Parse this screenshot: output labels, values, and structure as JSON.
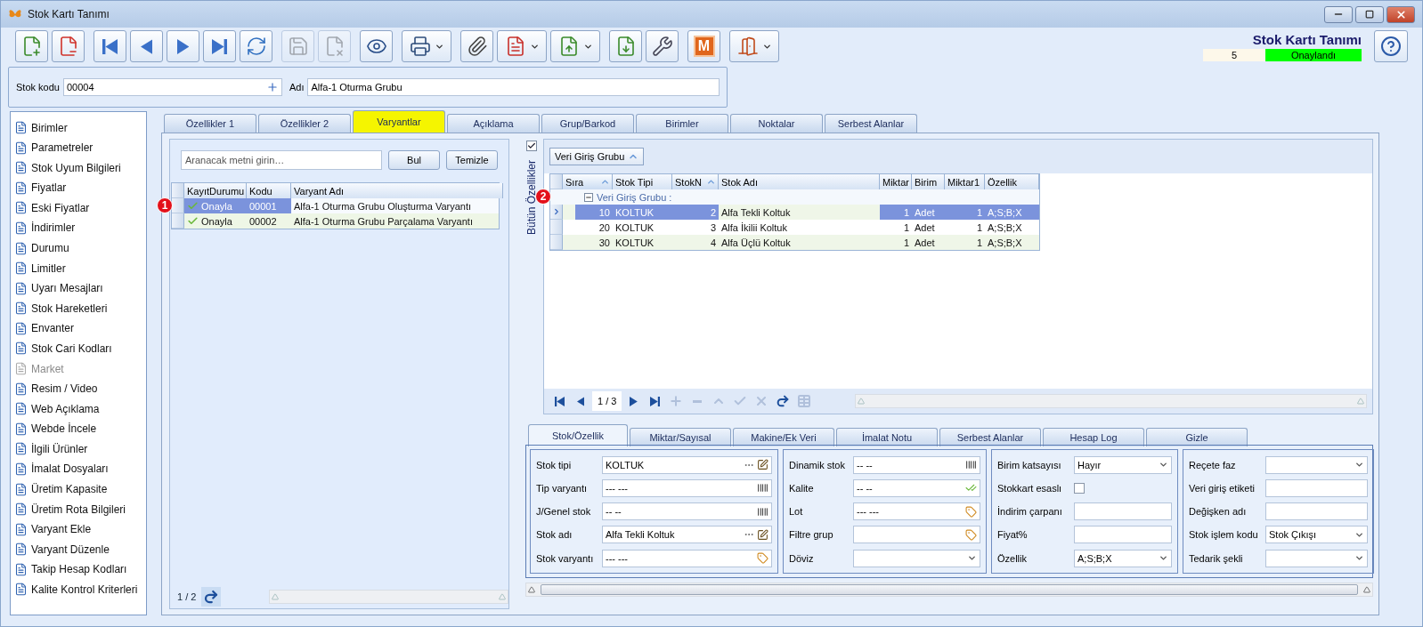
{
  "window": {
    "title": "Stok Kartı Tanımı"
  },
  "toolbar": [
    {
      "kind": "new",
      "disabled": false,
      "dropdown": false
    },
    {
      "kind": "delete",
      "disabled": false,
      "dropdown": false
    },
    {
      "kind": "first",
      "disabled": false,
      "dropdown": false
    },
    {
      "kind": "prev",
      "disabled": false,
      "dropdown": false
    },
    {
      "kind": "next",
      "disabled": false,
      "dropdown": false
    },
    {
      "kind": "last",
      "disabled": false,
      "dropdown": false
    },
    {
      "kind": "refresh",
      "disabled": false,
      "dropdown": false
    },
    {
      "kind": "save",
      "disabled": true,
      "dropdown": false
    },
    {
      "kind": "cancel",
      "disabled": true,
      "dropdown": false
    },
    {
      "kind": "preview",
      "disabled": false,
      "dropdown": false
    },
    {
      "kind": "print",
      "disabled": false,
      "dropdown": true
    },
    {
      "kind": "attach",
      "disabled": false,
      "dropdown": false
    },
    {
      "kind": "pdf",
      "disabled": false,
      "dropdown": true
    },
    {
      "kind": "export",
      "disabled": false,
      "dropdown": true
    },
    {
      "kind": "import",
      "disabled": false,
      "dropdown": false
    },
    {
      "kind": "tools",
      "disabled": false,
      "dropdown": false
    },
    {
      "kind": "module",
      "label": "M",
      "disabled": false,
      "dropdown": false
    },
    {
      "kind": "exit",
      "disabled": false,
      "dropdown": true
    }
  ],
  "header": {
    "title": "Stok Kartı Tanımı",
    "number": "5",
    "status": "Onaylandı"
  },
  "code_row": {
    "code_label": "Stok kodu",
    "code": "00004",
    "name_label": "Adı",
    "name": "Alfa-1 Oturma Grubu"
  },
  "sidebar": {
    "items": [
      {
        "label": "Birimler",
        "disabled": false
      },
      {
        "label": "Parametreler",
        "disabled": false
      },
      {
        "label": "Stok Uyum Bilgileri",
        "disabled": false
      },
      {
        "label": "Fiyatlar",
        "disabled": false
      },
      {
        "label": "Eski Fiyatlar",
        "disabled": false
      },
      {
        "label": "İndirimler",
        "disabled": false
      },
      {
        "label": "Durumu",
        "disabled": false
      },
      {
        "label": "Limitler",
        "disabled": false
      },
      {
        "label": "Uyarı Mesajları",
        "disabled": false
      },
      {
        "label": "Stok Hareketleri",
        "disabled": false
      },
      {
        "label": "Envanter",
        "disabled": false
      },
      {
        "label": "Stok Cari Kodları",
        "disabled": false
      },
      {
        "label": "Market",
        "disabled": true
      },
      {
        "label": "Resim / Video",
        "disabled": false
      },
      {
        "label": "Web Açıklama",
        "disabled": false
      },
      {
        "label": "Webde İncele",
        "disabled": false
      },
      {
        "label": "İlgili Ürünler",
        "disabled": false
      },
      {
        "label": "İmalat Dosyaları",
        "disabled": false
      },
      {
        "label": "Üretim Kapasite",
        "disabled": false
      },
      {
        "label": "Üretim Rota Bilgileri",
        "disabled": false
      },
      {
        "label": "Varyant Ekle",
        "disabled": false
      },
      {
        "label": "Varyant Düzenle",
        "disabled": false
      },
      {
        "label": "Takip Hesap Kodları",
        "disabled": false
      },
      {
        "label": "Kalite Kontrol Kriterleri",
        "disabled": false
      }
    ]
  },
  "tabs": [
    {
      "label": "Özellikler 1",
      "selected": false
    },
    {
      "label": "Özellikler 2",
      "selected": false
    },
    {
      "label": "Varyantlar",
      "selected": true
    },
    {
      "label": "Açıklama",
      "selected": false
    },
    {
      "label": "Grup/Barkod",
      "selected": false
    },
    {
      "label": "Birimler",
      "selected": false
    },
    {
      "label": "Noktalar",
      "selected": false
    },
    {
      "label": "Serbest Alanlar",
      "selected": false
    }
  ],
  "variants": {
    "search": {
      "placeholder": "Aranacak metni girin…"
    },
    "buttons": [
      "Bul",
      "Temizle"
    ],
    "columns": [
      "KayıtDurumu",
      "Kodu",
      "Varyant Adı"
    ],
    "rows": [
      {
        "status": "Onayla",
        "code": "00001",
        "name": "Alfa-1 Oturma Grubu Oluşturma Varyantı",
        "selected": true,
        "marker": "1"
      },
      {
        "status": "Onayla",
        "code": "00002",
        "name": "Alfa-1 Oturma Grubu Parçalama Varyantı",
        "selected": false
      }
    ],
    "pager": "1 / 2"
  },
  "properties": {
    "show_all": {
      "label": "Bütün Özellikler",
      "checked": true
    },
    "group_by": "Veri Giriş Grubu",
    "columns": [
      {
        "label": "Sıra",
        "sorted": true
      },
      {
        "label": "Stok Tipi",
        "sorted": false
      },
      {
        "label": "StokN",
        "sorted": true
      },
      {
        "label": "Stok Adı",
        "sorted": false
      },
      {
        "label": "Miktar",
        "sorted": false
      },
      {
        "label": "Birim",
        "sorted": false
      },
      {
        "label": "Miktar1",
        "sorted": false
      },
      {
        "label": "Özellik",
        "sorted": false
      }
    ],
    "group": {
      "label": "Veri Giriş Grubu :",
      "expanded": true,
      "marker": "2"
    },
    "rows": [
      {
        "cells": [
          "10",
          "KOLTUK",
          "2",
          "Alfa Tekli Koltuk",
          "1",
          "Adet",
          "1",
          "A;S;B;X"
        ],
        "selected": true
      },
      {
        "cells": [
          "20",
          "KOLTUK",
          "3",
          "Alfa İkilii Koltuk",
          "1",
          "Adet",
          "1",
          "A;S;B;X"
        ],
        "selected": false
      },
      {
        "cells": [
          "30",
          "KOLTUK",
          "4",
          "Alfa Üçlü Koltuk",
          "1",
          "Adet",
          "1",
          "A;S;B;X"
        ],
        "selected": false
      }
    ],
    "navigator": {
      "position": "1 / 3",
      "buttons": [
        {
          "kind": "first",
          "disabled": false
        },
        {
          "kind": "prev",
          "disabled": false
        },
        {
          "kind": "next",
          "disabled": false
        },
        {
          "kind": "last",
          "disabled": false
        },
        {
          "kind": "add",
          "disabled": true
        },
        {
          "kind": "remove",
          "disabled": true
        },
        {
          "kind": "up",
          "disabled": true
        },
        {
          "kind": "accept",
          "disabled": true
        },
        {
          "kind": "discard",
          "disabled": true
        },
        {
          "kind": "redo",
          "disabled": false
        },
        {
          "kind": "grid",
          "disabled": true
        }
      ]
    }
  },
  "detail_tabs": [
    {
      "label": "Stok/Özellik",
      "selected": true
    },
    {
      "label": "Miktar/Sayısal",
      "selected": false
    },
    {
      "label": "Makine/Ek Veri",
      "selected": false
    },
    {
      "label": "İmalat Notu",
      "selected": false
    },
    {
      "label": "Serbest Alanlar",
      "selected": false
    },
    {
      "label": "Hesap Log",
      "selected": false
    },
    {
      "label": "Gizle",
      "selected": false
    }
  ],
  "detail_groups": [
    [
      {
        "label": "Stok tipi",
        "value": "KOLTUK",
        "kind": "picker"
      },
      {
        "label": "Tip varyantı",
        "value": "--- ---",
        "kind": "barcode"
      },
      {
        "label": "J/Genel stok",
        "value": "-- --",
        "kind": "barcode"
      },
      {
        "label": "Stok adı",
        "value": "Alfa Tekli Koltuk",
        "kind": "picker"
      },
      {
        "label": "Stok varyantı",
        "value": "--- ---",
        "kind": "tag"
      }
    ],
    [
      {
        "label": "Dinamik stok",
        "value": "-- --",
        "kind": "barcode"
      },
      {
        "label": "Kalite",
        "value": "-- --",
        "kind": "quality"
      },
      {
        "label": "Lot",
        "value": "--- ---",
        "kind": "tag"
      },
      {
        "label": "Filtre grup",
        "kind": "tag"
      },
      {
        "label": "Döviz",
        "kind": "dropdown"
      }
    ],
    [
      {
        "label": "Birim katsayısı",
        "value": "Hayır",
        "kind": "dropdown"
      },
      {
        "label": "Stokkart esaslı",
        "kind": "checkbox",
        "checked": false
      },
      {
        "label": "İndirim çarpanı",
        "kind": "text"
      },
      {
        "label": "Fiyat%",
        "kind": "text"
      },
      {
        "label": "Özellik",
        "value": "A;S;B;X",
        "kind": "dropdown"
      }
    ],
    [
      {
        "label": "Reçete faz",
        "kind": "dropdown"
      },
      {
        "label": "Veri giriş etiketi",
        "kind": "text"
      },
      {
        "label": "Değişken adı",
        "kind": "text"
      },
      {
        "label": "Stok işlem kodu",
        "value": "Stok Çıkışı",
        "kind": "dropdown"
      },
      {
        "label": "Tedarik şekli",
        "kind": "dropdown"
      }
    ]
  ]
}
